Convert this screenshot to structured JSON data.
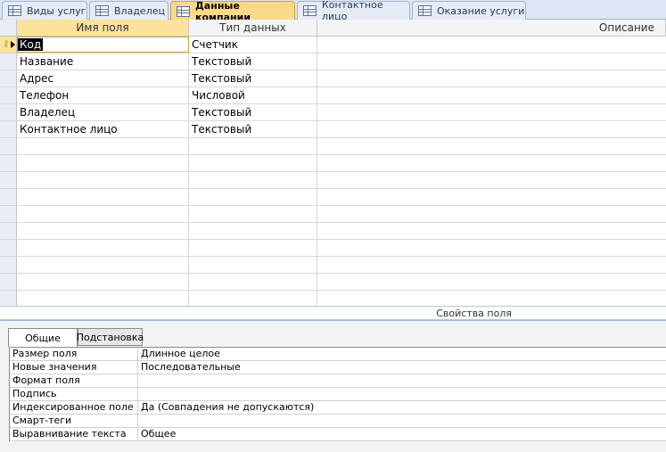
{
  "tabs": [
    {
      "label": "Виды услуг",
      "active": false
    },
    {
      "label": "Владелец",
      "active": false
    },
    {
      "label": "Данные компании",
      "active": true
    },
    {
      "label": "Контактное лицо",
      "active": false
    },
    {
      "label": "Оказание услуги",
      "active": false
    }
  ],
  "grid": {
    "headers": {
      "name": "Имя поля",
      "type": "Тип данных",
      "description": "Описание"
    },
    "rows": [
      {
        "name": "Код",
        "type": "Счетчик",
        "description": "",
        "primary_key": true
      },
      {
        "name": "Название",
        "type": "Текстовый",
        "description": ""
      },
      {
        "name": "Адрес",
        "type": "Текстовый",
        "description": ""
      },
      {
        "name": "Телефон",
        "type": "Числовой",
        "description": ""
      },
      {
        "name": "Владелец",
        "type": "Текстовый",
        "description": ""
      },
      {
        "name": "Контактное лицо",
        "type": "Текстовый",
        "description": ""
      }
    ]
  },
  "properties": {
    "title": "Свойства поля",
    "tabs": [
      "Общие",
      "Подстановка"
    ],
    "rows": [
      {
        "name": "Размер поля",
        "value": "Длинное целое"
      },
      {
        "name": "Новые значения",
        "value": "Последовательные"
      },
      {
        "name": "Формат поля",
        "value": ""
      },
      {
        "name": "Подпись",
        "value": ""
      },
      {
        "name": "Индексированное поле",
        "value": "Да (Совпадения не допускаются)"
      },
      {
        "name": "Смарт-теги",
        "value": ""
      },
      {
        "name": "Выравнивание текста",
        "value": "Общее"
      }
    ]
  }
}
